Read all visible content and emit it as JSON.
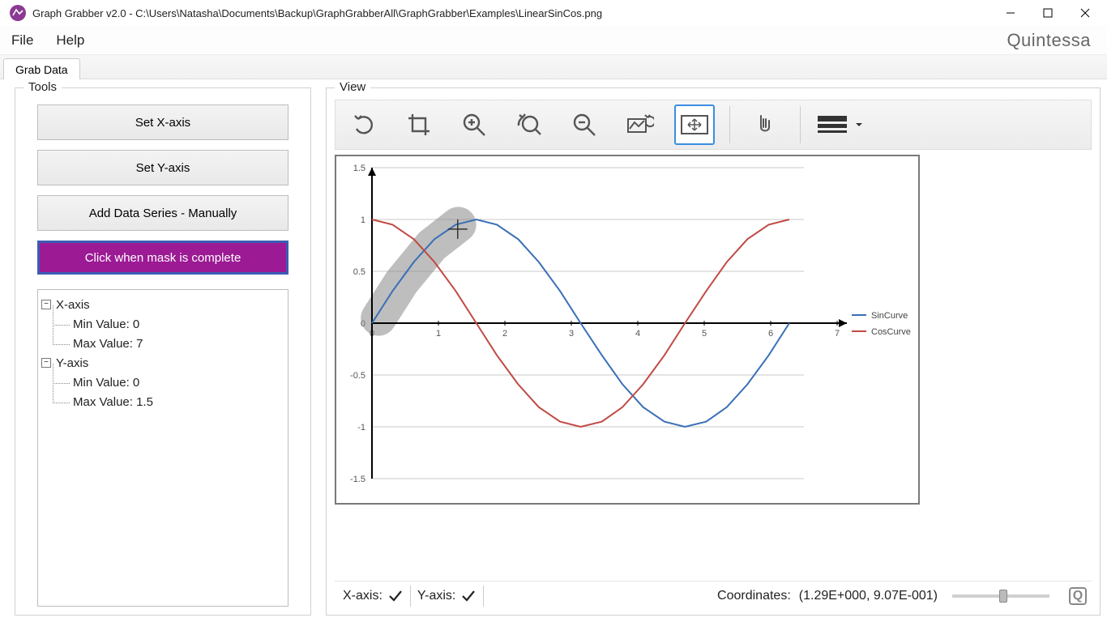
{
  "titlebar": {
    "title": "Graph Grabber v2.0 - C:\\Users\\Natasha\\Documents\\Backup\\GraphGrabberAll\\GraphGrabber\\Examples\\LinearSinCos.png"
  },
  "menubar": {
    "file": "File",
    "help": "Help",
    "brand": "Quintessa"
  },
  "tabs": {
    "grab_data": "Grab Data"
  },
  "tools": {
    "legend": "Tools",
    "set_x": "Set X-axis",
    "set_y": "Set Y-axis",
    "add_series": "Add Data Series - Manually",
    "mask": "Click when mask is complete",
    "tree": {
      "x_label": "X-axis",
      "x_min": "Min Value: 0",
      "x_max": "Max Value: 7",
      "y_label": "Y-axis",
      "y_min": "Min Value: 0",
      "y_max": "Max Value: 1.5"
    }
  },
  "view": {
    "legend": "View",
    "legend_items": {
      "sin": "SinCurve",
      "cos": "CosCurve"
    }
  },
  "statusbar": {
    "x_label": "X-axis:",
    "y_label": "Y-axis:",
    "coords_label": "Coordinates:",
    "coords_value": "(1.29E+000,   9.07E-001)"
  },
  "chart_data": {
    "type": "line",
    "xlabel": "",
    "ylabel": "",
    "xlim": [
      0,
      7
    ],
    "ylim": [
      -1.5,
      1.5
    ],
    "x_ticks": [
      0,
      1,
      2,
      3,
      4,
      5,
      6,
      7
    ],
    "y_ticks": [
      -1.5,
      -1,
      -0.5,
      0,
      0.5,
      1,
      1.5
    ],
    "series": [
      {
        "name": "SinCurve",
        "color": "#3a6fb7",
        "x": [
          0.0,
          0.31,
          0.63,
          0.94,
          1.26,
          1.57,
          1.88,
          2.2,
          2.51,
          2.83,
          3.14,
          3.46,
          3.77,
          4.08,
          4.4,
          4.71,
          5.03,
          5.34,
          5.65,
          5.97,
          6.28
        ],
        "values": [
          0.0,
          0.31,
          0.59,
          0.81,
          0.95,
          1.0,
          0.95,
          0.81,
          0.59,
          0.31,
          0.0,
          -0.31,
          -0.59,
          -0.81,
          -0.95,
          -1.0,
          -0.95,
          -0.81,
          -0.59,
          -0.31,
          0.0
        ]
      },
      {
        "name": "CosCurve",
        "color": "#c04a44",
        "x": [
          0.0,
          0.31,
          0.63,
          0.94,
          1.26,
          1.57,
          1.88,
          2.2,
          2.51,
          2.83,
          3.14,
          3.46,
          3.77,
          4.08,
          4.4,
          4.71,
          5.03,
          5.34,
          5.65,
          5.97,
          6.28
        ],
        "values": [
          1.0,
          0.95,
          0.81,
          0.59,
          0.31,
          0.0,
          -0.31,
          -0.59,
          -0.81,
          -0.95,
          -1.0,
          -0.95,
          -0.81,
          -0.59,
          -0.31,
          0.0,
          0.31,
          0.59,
          0.81,
          0.95,
          1.0
        ]
      }
    ],
    "mask_stroke": [
      {
        "x": 0.1,
        "y": 0.05
      },
      {
        "x": 0.45,
        "y": 0.4
      },
      {
        "x": 0.9,
        "y": 0.75
      },
      {
        "x": 1.3,
        "y": 0.95
      }
    ],
    "crosshair": {
      "x": 1.29,
      "y": 0.907
    }
  }
}
